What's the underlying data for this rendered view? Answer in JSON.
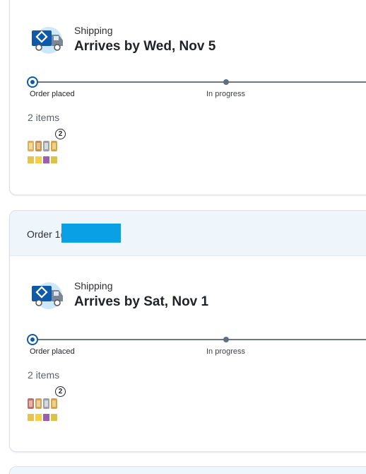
{
  "orders": [
    {
      "status": "Shipping",
      "arrival": "Arrives by Wed, Nov 5",
      "progress_steps": [
        "Order placed",
        "In progress"
      ],
      "items_count": "2 items",
      "quantity_badge": "2"
    },
    {
      "order_label": "Order 1(",
      "status": "Shipping",
      "arrival": "Arrives by Sat, Nov 1",
      "progress_steps": [
        "Order placed",
        "In progress"
      ],
      "items_count": "2 items",
      "quantity_badge": "2"
    }
  ],
  "colors": {
    "accent_blue": "#0f5aa8",
    "header_bg": "#eef6fc",
    "redaction": "#0aa0e6"
  },
  "icons": [
    "delivery-truck-icon",
    "product-thumbnail"
  ]
}
